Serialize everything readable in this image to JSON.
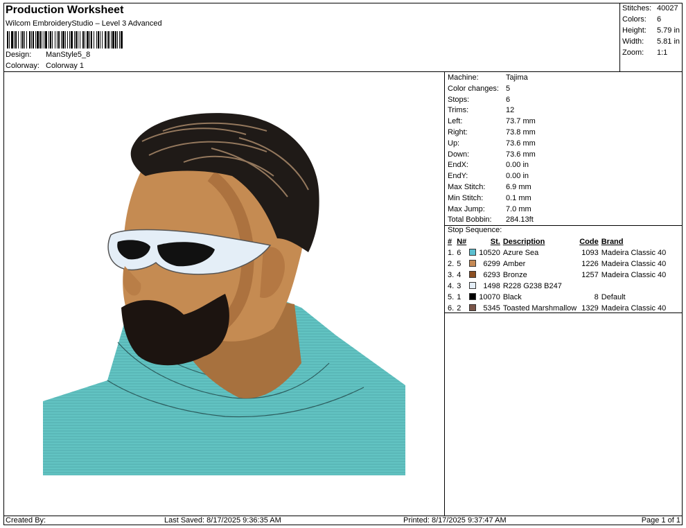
{
  "header": {
    "title": "Production Worksheet",
    "subtitle": "Wilcom EmbroideryStudio – Level 3 Advanced",
    "design_label": "Design:",
    "design_value": "ManStyle5_8",
    "colorway_label": "Colorway:",
    "colorway_value": "Colorway 1"
  },
  "stats": {
    "stitches_label": "Stitches:",
    "stitches_value": "40027",
    "colors_label": "Colors:",
    "colors_value": "6",
    "height_label": "Height:",
    "height_value": "5.79 in",
    "width_label": "Width:",
    "width_value": "5.81 in",
    "zoom_label": "Zoom:",
    "zoom_value": "1:1"
  },
  "props": {
    "machine_label": "Machine:",
    "machine_value": "Tajima",
    "color_changes_label": "Color changes:",
    "color_changes_value": "5",
    "stops_label": "Stops:",
    "stops_value": "6",
    "trims_label": "Trims:",
    "trims_value": "12",
    "left_label": "Left:",
    "left_value": "73.7 mm",
    "right_label": "Right:",
    "right_value": "73.8 mm",
    "up_label": "Up:",
    "up_value": "73.6 mm",
    "down_label": "Down:",
    "down_value": "73.6 mm",
    "endx_label": "EndX:",
    "endx_value": "0.00 in",
    "endy_label": "EndY:",
    "endy_value": "0.00 in",
    "max_stitch_label": "Max Stitch:",
    "max_stitch_value": "6.9 mm",
    "min_stitch_label": "Min Stitch:",
    "min_stitch_value": "0.1 mm",
    "max_jump_label": "Max Jump:",
    "max_jump_value": "7.0 mm",
    "total_bobbin_label": "Total Bobbin:",
    "total_bobbin_value": "284.13ft"
  },
  "stop_sequence": {
    "title": "Stop Sequence:",
    "columns": {
      "num": "#",
      "n": "N#",
      "st": "St.",
      "description": "Description",
      "code": "Code",
      "brand": "Brand"
    },
    "rows": [
      {
        "num": "1.",
        "n": "6",
        "color": "#5bbfd0",
        "st": "10520",
        "description": "Azure Sea",
        "code": "1093",
        "brand": "Madeira Classic 40"
      },
      {
        "num": "2.",
        "n": "5",
        "color": "#c68a55",
        "st": "6299",
        "description": "Amber",
        "code": "1226",
        "brand": "Madeira Classic 40"
      },
      {
        "num": "3.",
        "n": "4",
        "color": "#8c4f22",
        "st": "6293",
        "description": "Bronze",
        "code": "1257",
        "brand": "Madeira Classic 40"
      },
      {
        "num": "4.",
        "n": "3",
        "color": "#e4eef7",
        "st": "1498",
        "description": "R228 G238 B247",
        "code": "",
        "brand": ""
      },
      {
        "num": "5.",
        "n": "1",
        "color": "#000000",
        "st": "10070",
        "description": "Black",
        "code": "8",
        "brand": "Default"
      },
      {
        "num": "6.",
        "n": "2",
        "color": "#7a5548",
        "st": "5345",
        "description": "Toasted Marshmallow",
        "code": "1329",
        "brand": "Madeira Classic 40"
      }
    ]
  },
  "footer": {
    "created_by": "Created By:",
    "last_saved": "Last Saved: 8/17/2025 9:36:35 AM",
    "printed": "Printed: 8/17/2025 9:37:47 AM",
    "page": "Page 1 of 1"
  }
}
